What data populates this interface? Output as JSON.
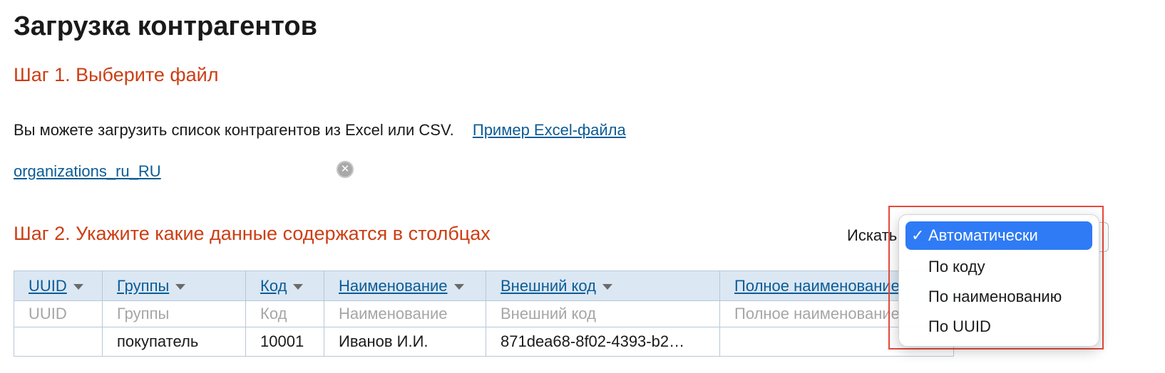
{
  "page": {
    "title": "Загрузка контрагентов"
  },
  "step1": {
    "title": "Шаг 1. Выберите файл",
    "info_text": "Вы можете загрузить список контрагентов из Excel или CSV.",
    "example_link": "Пример Excel-файла",
    "file_name": "organizations_ru_RU",
    "remove_icon": "close-circle-icon"
  },
  "step2": {
    "title": "Шаг 2. Укажите какие данные содержатся в столбцах",
    "search_label": "Искать"
  },
  "dropdown": {
    "check_glyph": "✓",
    "selected_index": 0,
    "accent_color": "#2f7bf5",
    "options": [
      "Автоматически",
      "По коду",
      "По наименованию",
      "По UUID"
    ]
  },
  "table": {
    "columns": [
      "UUID",
      "Группы",
      "Код",
      "Наименование",
      "Внешний код",
      "Полное наименование"
    ],
    "hint_row": [
      "UUID",
      "Группы",
      "Код",
      "Наименование",
      "Внешний код",
      "Полное наименование"
    ],
    "rows": [
      [
        "",
        "покупатель",
        "10001",
        "Иванов И.И.",
        "871dea68-8f02-4393-b2…",
        ""
      ]
    ]
  },
  "colors": {
    "heading_accent": "#cc3e14",
    "link": "#0b5c96",
    "header_bg": "#dbe7f3"
  }
}
